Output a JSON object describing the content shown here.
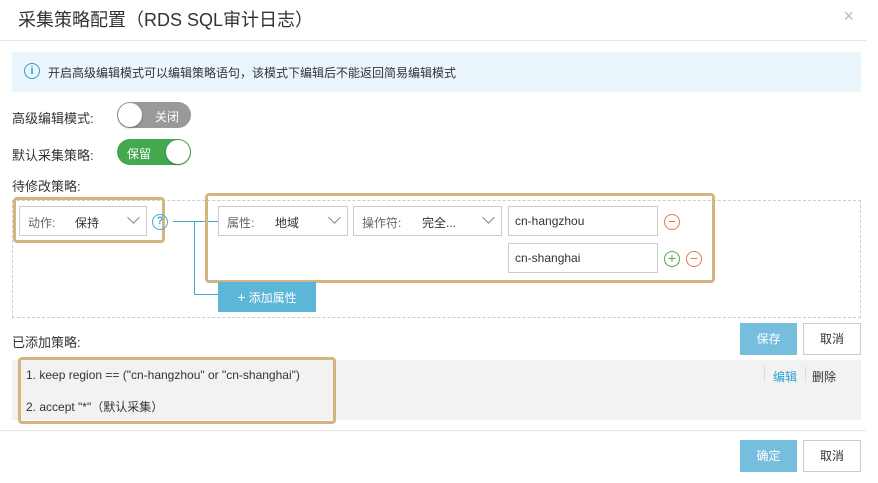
{
  "dialog": {
    "title": "采集策略配置（RDS SQL审计日志）",
    "close": "×"
  },
  "info": {
    "icon": "i",
    "text": "开启高级编辑模式可以编辑策略语句，该模式下编辑后不能返回简易编辑模式"
  },
  "advanced_mode": {
    "label": "高级编辑模式:",
    "toggle_text": "关闭",
    "state": "off"
  },
  "default_policy": {
    "label": "默认采集策略:",
    "toggle_text": "保留",
    "state": "on"
  },
  "pending": {
    "label": "待修改策略:",
    "action": {
      "label": "动作:",
      "value": "保持"
    },
    "help_icon": "?",
    "attribute": {
      "label": "属性:",
      "value": "地域"
    },
    "operator": {
      "label": "操作符:",
      "value": "完全..."
    },
    "values": [
      "cn-hangzhou",
      "cn-shanghai"
    ],
    "add_attribute": "添加属性",
    "add_glyph": "+",
    "minus_glyph": "−",
    "plus_glyph": "+"
  },
  "added": {
    "label": "已添加策略:",
    "save": "保存",
    "cancel": "取消",
    "policies": [
      "1. keep region == (\"cn-hangzhou\" or \"cn-shanghai\")",
      "2. accept \"*\"（默认采集）"
    ],
    "edit": "编辑",
    "delete": "删除"
  },
  "footer": {
    "confirm": "确定",
    "cancel": "取消"
  },
  "colors": {
    "highlight_border": "#d4b481",
    "primary_button": "#76bedd",
    "toggle_on": "#44a84f",
    "toggle_off": "#999999",
    "link": "#2f9fd8"
  }
}
